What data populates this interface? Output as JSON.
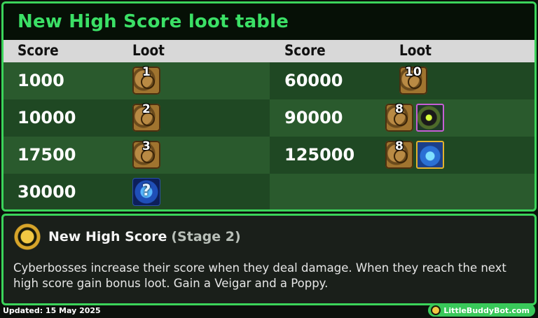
{
  "title": "New High Score loot table",
  "headers": {
    "score": "Score",
    "loot": "Loot"
  },
  "rows_left": [
    {
      "score": "1000",
      "loot_count": "1"
    },
    {
      "score": "10000",
      "loot_count": "2"
    },
    {
      "score": "17500",
      "loot_count": "3"
    },
    {
      "score": "30000",
      "loot_icon": "mystery-orb-icon",
      "loot_symbol": "?"
    }
  ],
  "rows_right": [
    {
      "score": "60000",
      "loot_count": "10"
    },
    {
      "score": "90000",
      "loot_count": "8",
      "champion_icon": "veigar-icon"
    },
    {
      "score": "125000",
      "loot_count": "8",
      "champion_icon": "poppy-icon"
    }
  ],
  "trait": {
    "name": "New High Score",
    "stage": "(Stage 2)",
    "description": "Cyberbosses increase their score when they deal damage. When they reach the next high score gain bonus loot. Gain a Veigar and a Poppy."
  },
  "footer": {
    "updated": "Updated: 15 May 2025",
    "brand": "LittleBuddyBot.com"
  },
  "colors": {
    "accent_green": "#3be066",
    "row_dark": "#1f4823",
    "row_light": "#2a5a2d"
  }
}
